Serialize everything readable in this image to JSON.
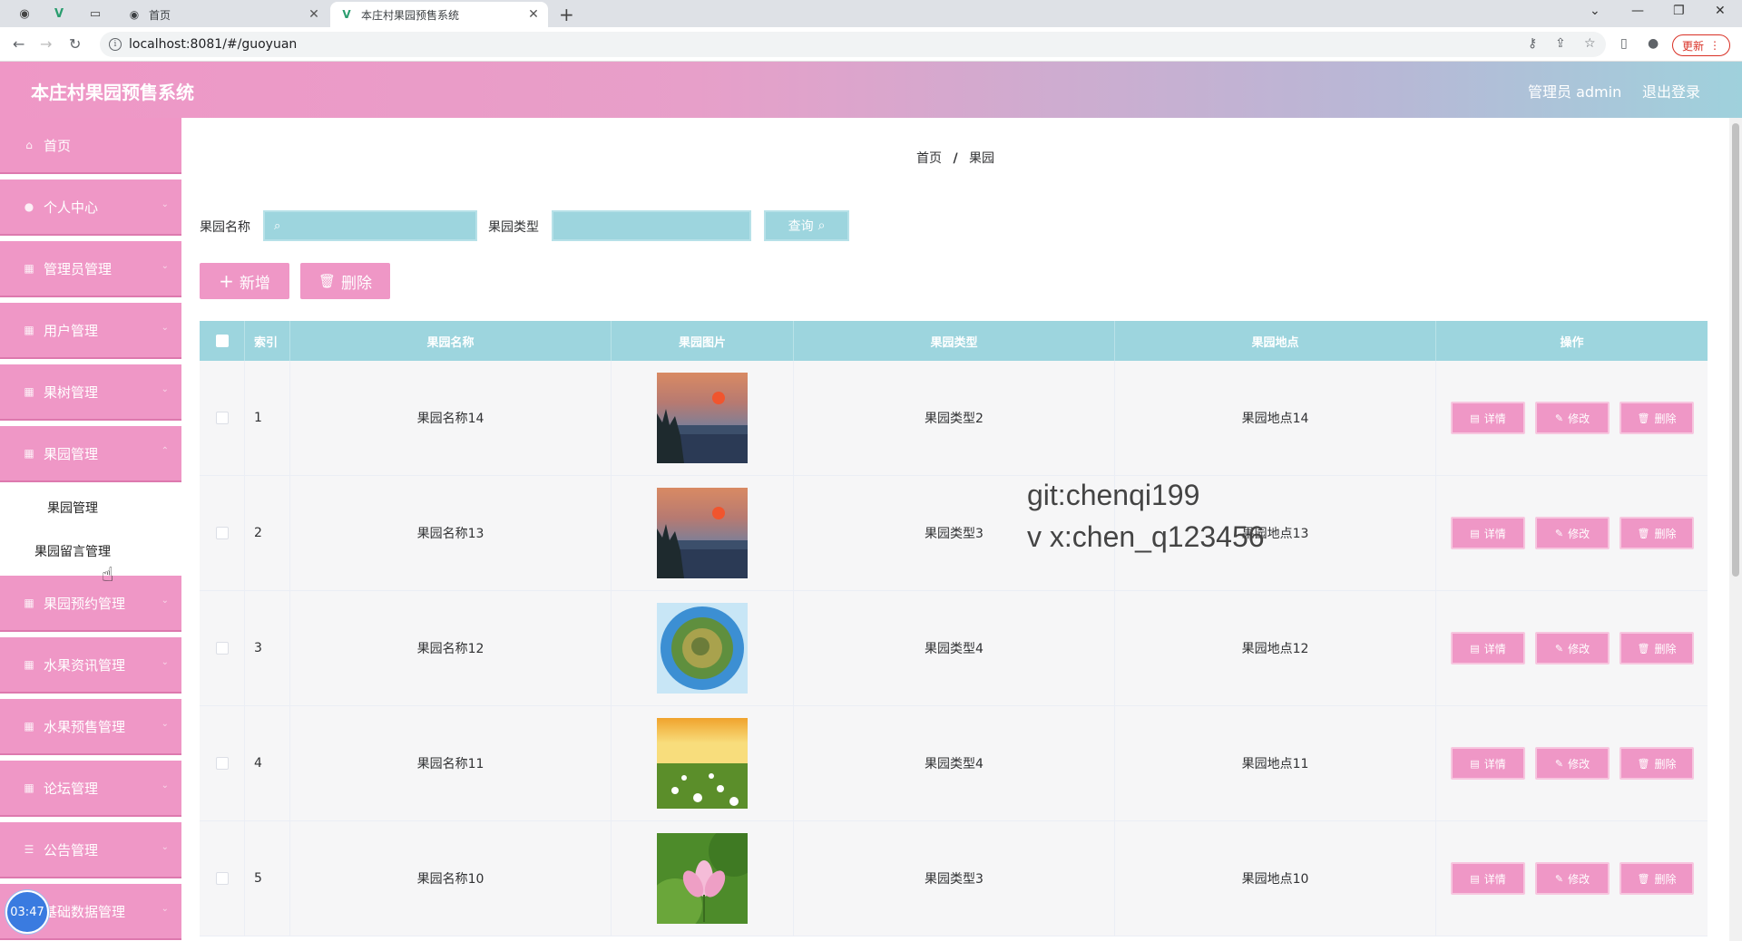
{
  "browser": {
    "tabs": [
      {
        "title": "首页",
        "active": false
      },
      {
        "title": "本庄村果园预售系统",
        "active": true
      }
    ],
    "new_tab": "+",
    "url": "localhost:8081/#/guoyuan",
    "update_label": "更新"
  },
  "header": {
    "title": "本庄村果园预售系统",
    "admin_label": "管理员 admin",
    "logout_label": "退出登录"
  },
  "sidebar": {
    "items": [
      {
        "label": "首页",
        "icon": "home-icon"
      },
      {
        "label": "个人中心",
        "icon": "user-icon"
      },
      {
        "label": "管理员管理",
        "icon": "grid-icon"
      },
      {
        "label": "用户管理",
        "icon": "grid-icon"
      },
      {
        "label": "果树管理",
        "icon": "grid-icon"
      },
      {
        "label": "果园管理",
        "icon": "grid-icon"
      },
      {
        "label": "果园预约管理",
        "icon": "grid-icon"
      },
      {
        "label": "水果资讯管理",
        "icon": "grid-icon"
      },
      {
        "label": "水果预售管理",
        "icon": "grid-icon"
      },
      {
        "label": "论坛管理",
        "icon": "grid-icon"
      },
      {
        "label": "公告管理",
        "icon": "list-icon"
      },
      {
        "label": "基础数据管理",
        "icon": "grid-icon"
      }
    ],
    "submenu": [
      "果园管理",
      "果园留言管理"
    ],
    "clock": "03:47"
  },
  "breadcrumb": {
    "home": "首页",
    "current": "果园"
  },
  "search": {
    "name_label": "果园名称",
    "type_label": "果园类型",
    "query_label": "查询"
  },
  "toolbar": {
    "add_label": "新增",
    "delete_label": "删除"
  },
  "table": {
    "columns": [
      "索引",
      "果园名称",
      "果园图片",
      "果园类型",
      "果园地点",
      "操作"
    ],
    "rows": [
      {
        "index": "1",
        "name": "果园名称14",
        "type": "果园类型2",
        "location": "果园地点14",
        "image": "sunset-lake"
      },
      {
        "index": "2",
        "name": "果园名称13",
        "type": "果园类型3",
        "location": "果园地点13",
        "image": "sunset-lake"
      },
      {
        "index": "3",
        "name": "果园名称12",
        "type": "果园类型4",
        "location": "果园地点12",
        "image": "tiny-planet"
      },
      {
        "index": "4",
        "name": "果园名称11",
        "type": "果园类型4",
        "location": "果园地点11",
        "image": "flower-meadow"
      },
      {
        "index": "5",
        "name": "果园名称10",
        "type": "果园类型3",
        "location": "果园地点10",
        "image": "lotus"
      }
    ],
    "actions": {
      "detail": "详情",
      "edit": "修改",
      "delete": "删除"
    }
  },
  "watermark": {
    "line1": "git:chenqi199",
    "line2": "v x:chen_q123456"
  },
  "colors": {
    "accent_pink": "#ef97c6",
    "accent_teal": "#9dd5de"
  }
}
